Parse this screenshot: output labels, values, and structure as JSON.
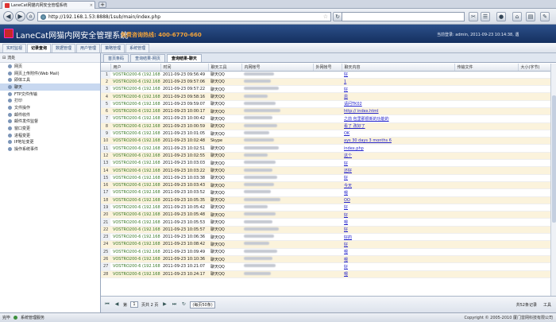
{
  "browser": {
    "tab_title": "LaneCat网猫内网安全管理系统",
    "url": "http://192.168.1.53:8888/1sub/main/index.php"
  },
  "header": {
    "title": "LaneCat网猫内网安全管理系统",
    "hotline": "免费咨询热线: 400-6770-660",
    "user_info": "当前登录: admin, 2011-09-23 10:14:38, 遇"
  },
  "menu": [
    "实时监视",
    "记录查询",
    "数据管理",
    "用户管理",
    "策略管理",
    "系统管理"
  ],
  "sidebar": {
    "title": "流处",
    "items": [
      "网页",
      "网页上传附件(Web Mail)",
      "即体工具",
      "聊天",
      "FTP文件传输",
      "打印",
      "文件操作",
      "邮件收件",
      "邮件发件监督",
      "窗口变更",
      "进程变更",
      "IP地址变更",
      "操作系统事件"
    ]
  },
  "tabs": [
    "首页条码",
    "查询结果-网页",
    "查询结果-聊天"
  ],
  "grid": {
    "headers": [
      "",
      "用户",
      "时间",
      "聊天工具",
      "内网帐号",
      "外网帐号",
      "聊天内容",
      "传输文件",
      "大小(字节)"
    ],
    "rows": [
      {
        "n": "1",
        "user": "VOSTRO200-6 (192.168...",
        "time": "2011-09-23 09:56:49",
        "tool": "聊天QQ",
        "content": "好"
      },
      {
        "n": "2",
        "user": "VOSTRO200-6 (192.168...",
        "time": "2011-09-23 09:57:06",
        "tool": "聊天QQ",
        "content": "1"
      },
      {
        "n": "3",
        "user": "VOSTRO200-6 (192.168...",
        "time": "2011-09-23 09:57:22",
        "tool": "聊天QQ",
        "content": "好"
      },
      {
        "n": "4",
        "user": "VOSTRO200-6 (192.168...",
        "time": "2011-09-23 09:58:16",
        "tool": "聊天QQ",
        "content": "恩"
      },
      {
        "n": "5",
        "user": "VOSTRO200-6 (192.168...",
        "time": "2011-09-23 09:59:07",
        "tool": "聊天QQ",
        "content": "请问TK02"
      },
      {
        "n": "6",
        "user": "VOSTRO200-6 (192.168...",
        "time": "2011-09-23 10:00:17",
        "tool": "聊天QQ",
        "content": "http:// index.html"
      },
      {
        "n": "7",
        "user": "VOSTRO200-6 (192.168...",
        "time": "2011-09-23 10:00:42",
        "tool": "聊天QQ",
        "content": "之前 包里那很新的功能的"
      },
      {
        "n": "8",
        "user": "VOSTRO200-6 (192.168...",
        "time": "2011-09-23 10:00:59",
        "tool": "聊天QQ",
        "content": "看了 改好了"
      },
      {
        "n": "9",
        "user": "VOSTRO200-6 (192.168...",
        "time": "2011-09-23 10:01:05",
        "tool": "聊天QQ",
        "content": "OK"
      },
      {
        "n": "10",
        "user": "VOSTRO200-6 (192.168...",
        "time": "2011-09-23 10:02:48",
        "tool": "Skype",
        "content": "ays 30 days 3 months 6"
      },
      {
        "n": "11",
        "user": "VOSTRO200-6 (192.168...",
        "time": "2011-09-23 10:02:51",
        "tool": "聊天QQ",
        "content": "index.php"
      },
      {
        "n": "12",
        "user": "VOSTRO200-6 (192.168...",
        "time": "2011-09-23 10:02:55",
        "tool": "聊天QQ",
        "content": "这个"
      },
      {
        "n": "13",
        "user": "VOSTRO200-6 (192.168...",
        "time": "2011-09-23 10:03:03",
        "tool": "聊天QQ",
        "content": "好"
      },
      {
        "n": "14",
        "user": "VOSTRO200-6 (192.168...",
        "time": "2011-09-23 10:03:22",
        "tool": "聊天QQ",
        "content": "还好"
      },
      {
        "n": "15",
        "user": "VOSTRO200-6 (192.168...",
        "time": "2011-09-23 10:03:38",
        "tool": "聊天QQ",
        "content": "好"
      },
      {
        "n": "16",
        "user": "VOSTRO200-6 (192.168...",
        "time": "2011-09-23 10:03:43",
        "tool": "聊天QQ",
        "content": "今天"
      },
      {
        "n": "17",
        "user": "VOSTRO200-6 (192.168...",
        "time": "2011-09-23 10:03:52",
        "tool": "聊天QQ",
        "content": "嗯"
      },
      {
        "n": "18",
        "user": "VOSTRO200-6 (192.168...",
        "time": "2011-09-23 10:05:35",
        "tool": "聊天QQ",
        "content": "OO"
      },
      {
        "n": "19",
        "user": "VOSTRO200-6 (192.168...",
        "time": "2011-09-23 10:05:42",
        "tool": "聊天QQ",
        "content": "好"
      },
      {
        "n": "20",
        "user": "VOSTRO200-6 (192.168...",
        "time": "2011-09-23 10:05:48",
        "tool": "聊天QQ",
        "content": "好"
      },
      {
        "n": "21",
        "user": "VOSTRO200-6 (192.168...",
        "time": "2011-09-23 10:05:53",
        "tool": "聊天QQ",
        "content": "嗯"
      },
      {
        "n": "22",
        "user": "VOSTRO200-6 (192.168...",
        "time": "2011-09-23 10:05:57",
        "tool": "聊天QQ",
        "content": "好"
      },
      {
        "n": "23",
        "user": "VOSTRO200-6 (192.168...",
        "time": "2011-09-23 10:06:36",
        "tool": "聊天QQ",
        "content": "好的"
      },
      {
        "n": "24",
        "user": "VOSTRO200-6 (192.168...",
        "time": "2011-09-23 10:08:42",
        "tool": "聊天QQ",
        "content": "好"
      },
      {
        "n": "25",
        "user": "VOSTRO200-6 (192.168...",
        "time": "2011-09-23 10:09:49",
        "tool": "聊天QQ",
        "content": "嗯"
      },
      {
        "n": "26",
        "user": "VOSTRO200-6 (192.168...",
        "time": "2011-09-23 10:10:36",
        "tool": "聊天QQ",
        "content": "嗯"
      },
      {
        "n": "27",
        "user": "VOSTRO200-6 (192.168...",
        "time": "2011-09-23 10:21:07",
        "tool": "聊天QQ",
        "content": "好"
      },
      {
        "n": "28",
        "user": "VOSTRO200-6 (192.168...",
        "time": "2011-09-23 10:24:17",
        "tool": "聊天QQ",
        "content": "嗯"
      }
    ]
  },
  "pager": {
    "page_label": "第",
    "page_value": "1",
    "of_label": "页共 2 页",
    "page_size": "(每页50条)",
    "total": "共52条记录",
    "tools": "工具"
  },
  "status": {
    "done": "完毕",
    "service": "系统管理服务",
    "copyright": "Copyright © 2005-2010 厦门雷网科技有限公司"
  }
}
